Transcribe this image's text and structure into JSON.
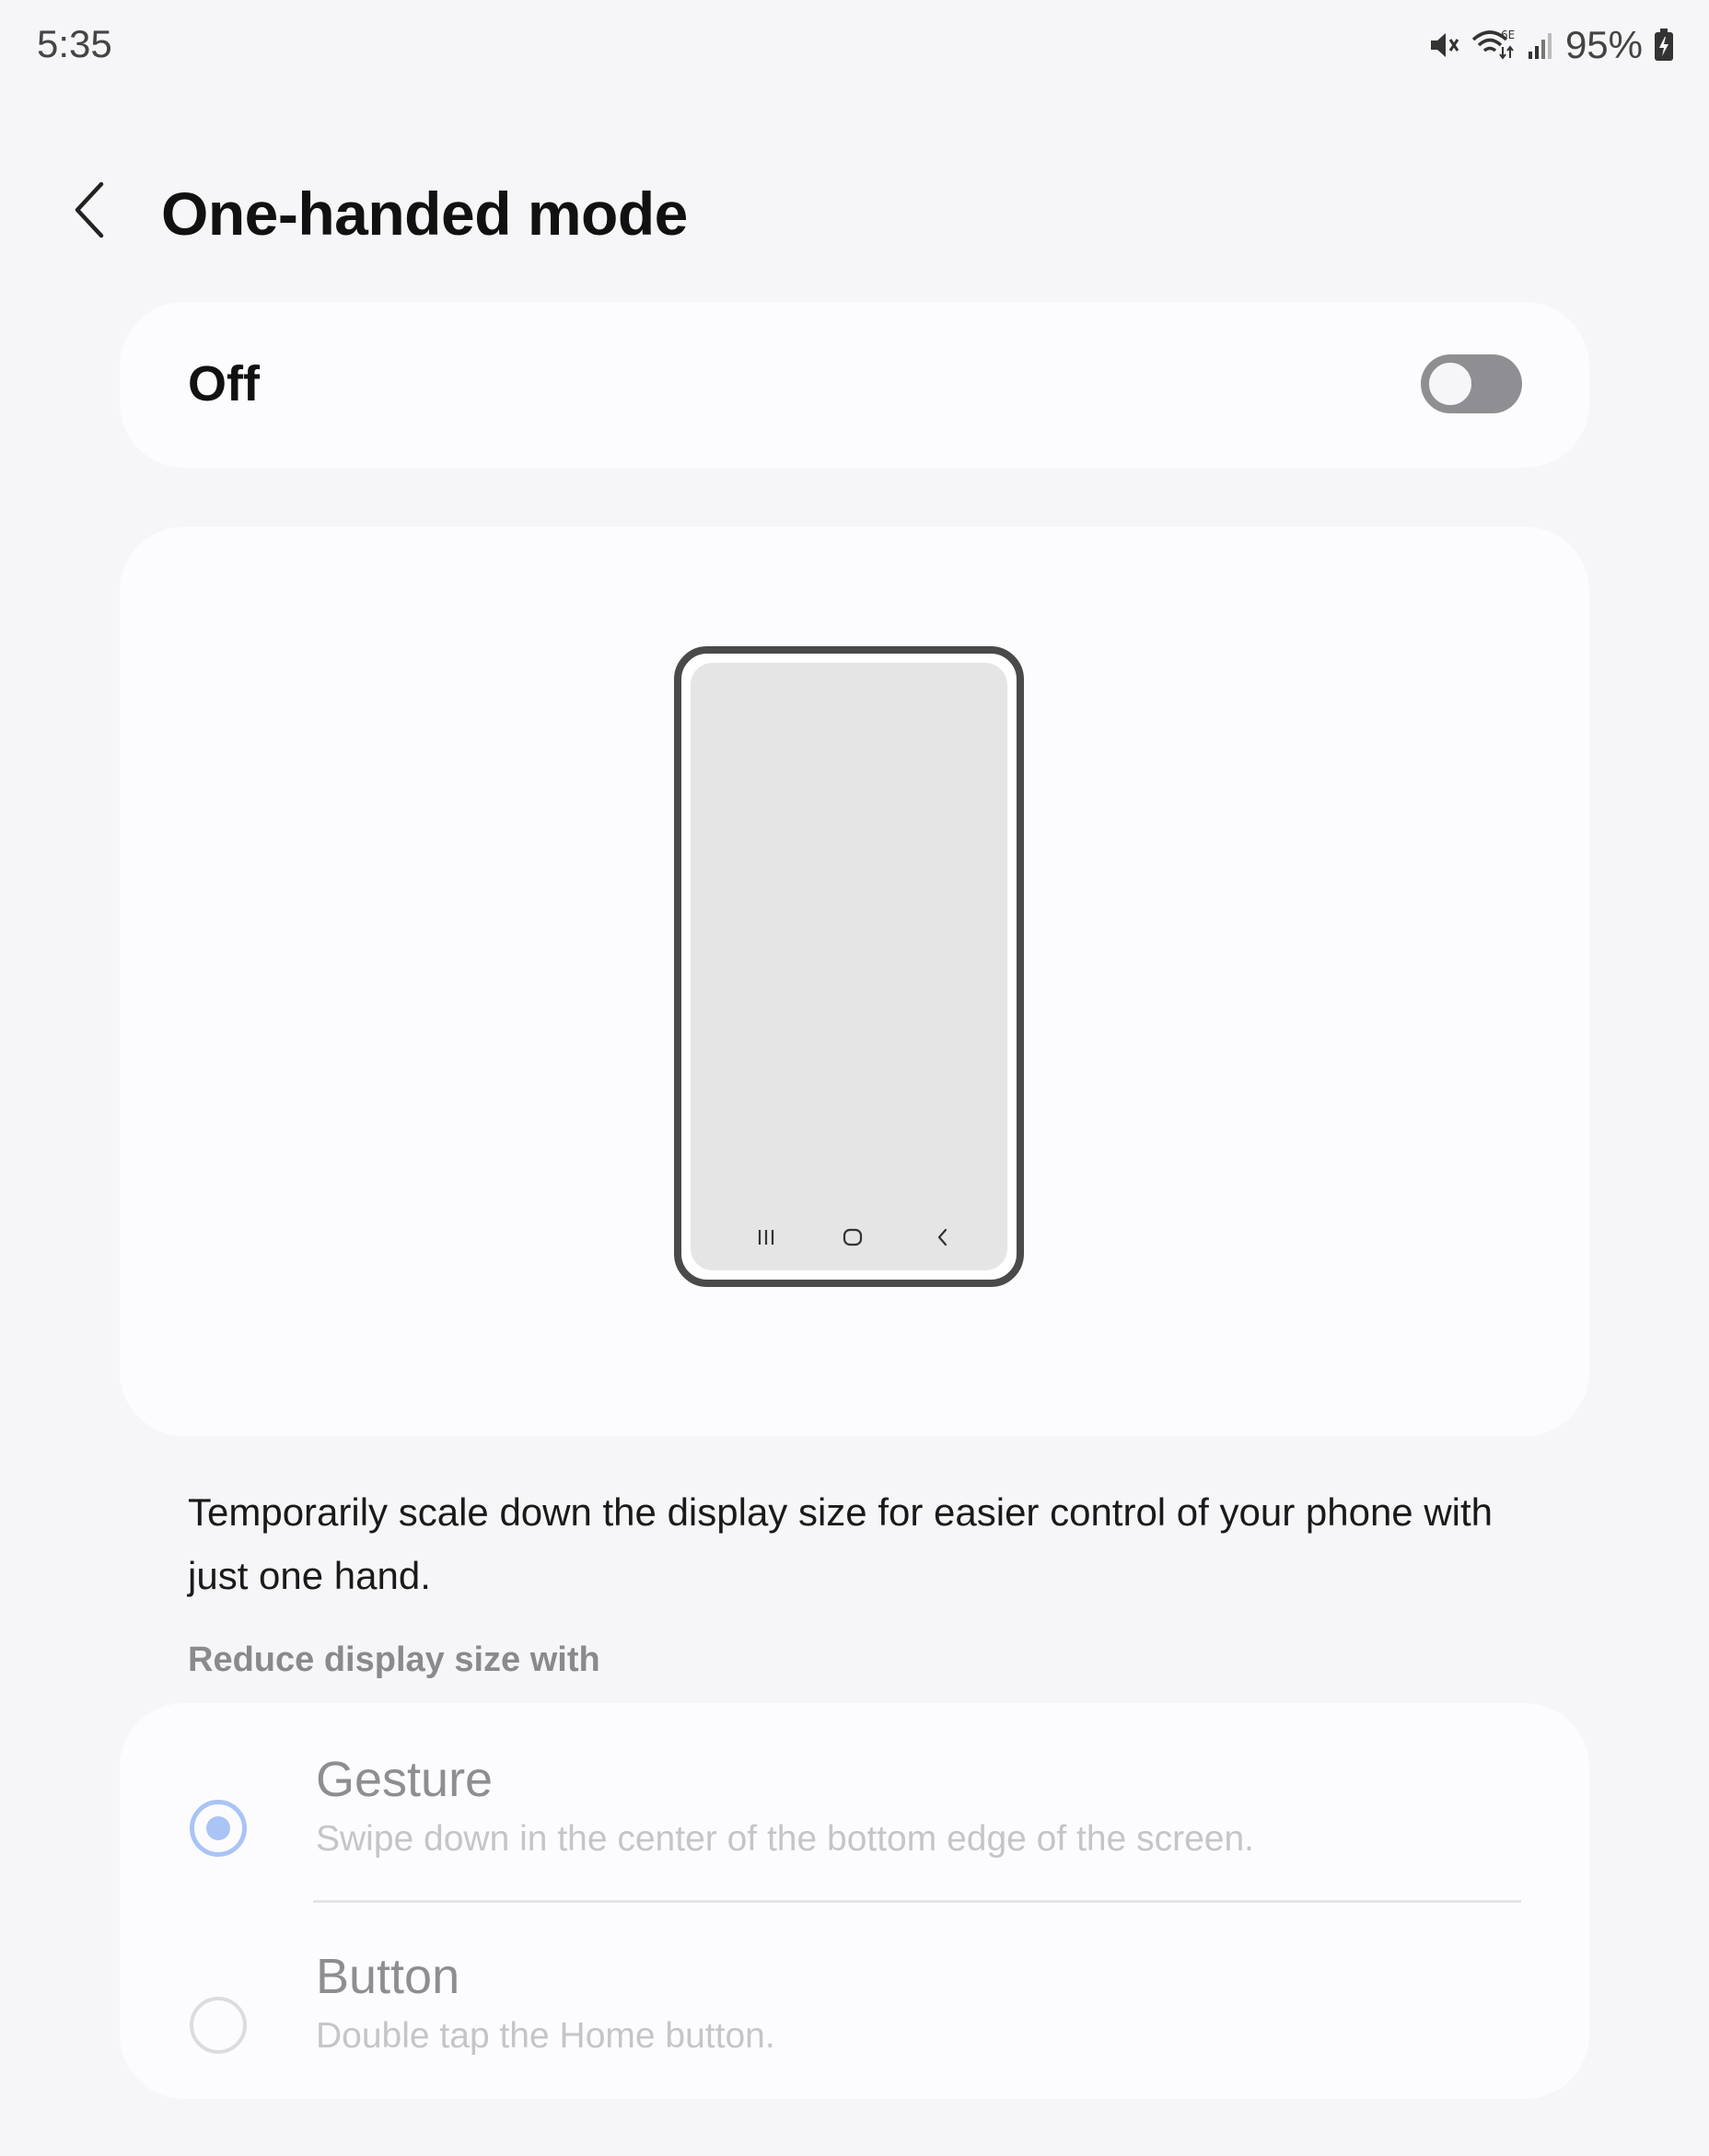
{
  "status_bar": {
    "time": "5:35",
    "battery": "95%",
    "icons": [
      "mute-icon",
      "wifi-6e-icon",
      "signal-icon",
      "battery-charging-icon"
    ]
  },
  "header": {
    "title": "One-handed mode",
    "back_icon": "chevron-left-icon"
  },
  "master_switch": {
    "label": "Off",
    "checked": false
  },
  "illustration": {
    "nav_icons": [
      "recents-icon",
      "home-icon",
      "back-icon"
    ]
  },
  "description": "Temporarily scale down the display size for easier control of your phone with just one hand.",
  "section_header": "Reduce display size with",
  "options": [
    {
      "title": "Gesture",
      "description": "Swipe down in the center of the bottom edge of the screen.",
      "selected": true,
      "enabled": false
    },
    {
      "title": "Button",
      "description": "Double tap the Home button.",
      "selected": false,
      "enabled": false
    }
  ],
  "colors": {
    "background": "#f6f6f8",
    "card": "#fcfcfe",
    "switch_off": "#8e8e93",
    "radio_accent_disabled": "#a9c4f5"
  }
}
